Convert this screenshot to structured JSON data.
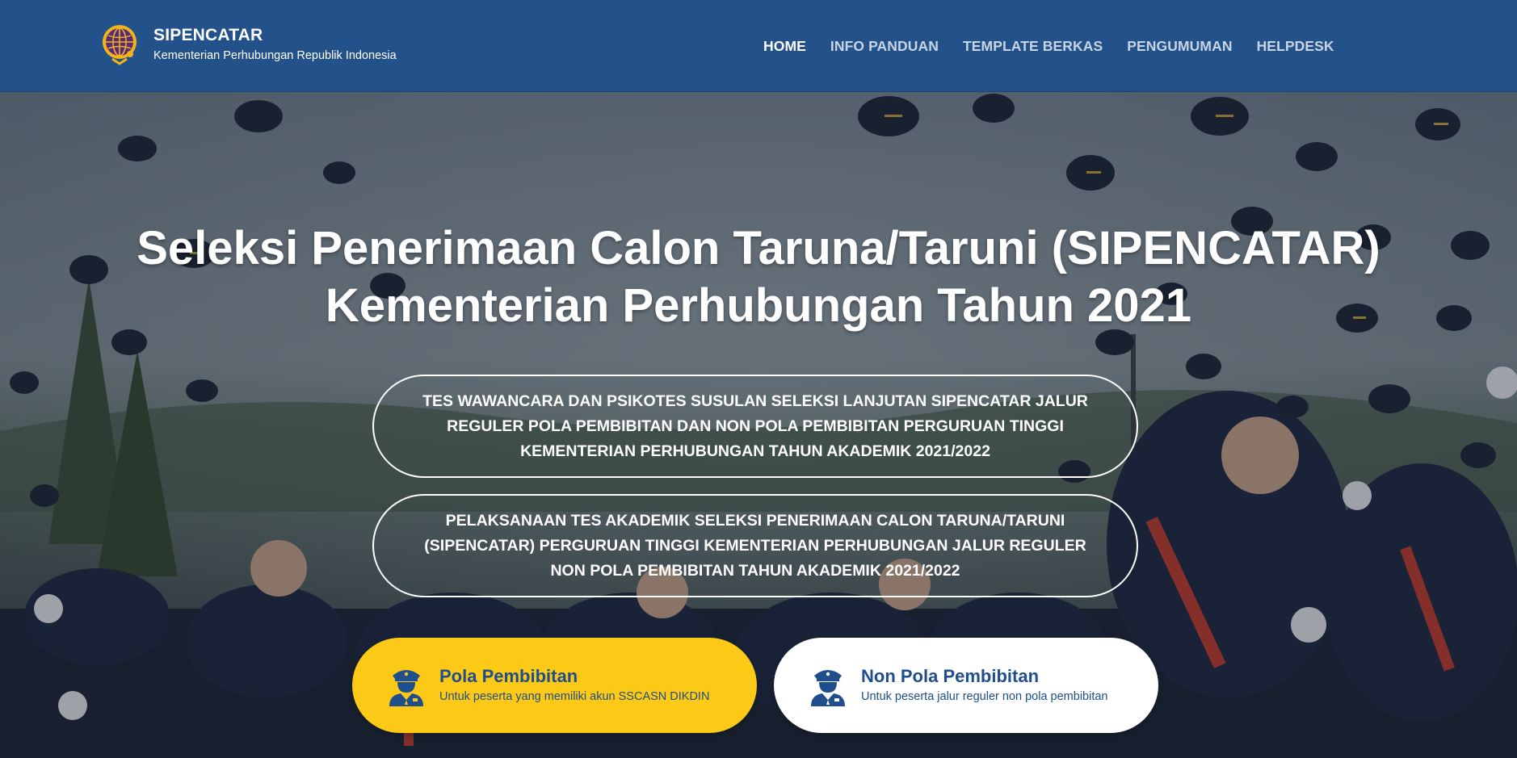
{
  "header": {
    "title": "SIPENCATAR",
    "subtitle": "Kementerian Perhubungan Republik Indonesia",
    "nav": [
      {
        "label": "HOME",
        "active": true
      },
      {
        "label": "INFO PANDUAN",
        "active": false
      },
      {
        "label": "TEMPLATE BERKAS",
        "active": false
      },
      {
        "label": "PENGUMUMAN",
        "active": false
      },
      {
        "label": "HELPDESK",
        "active": false
      }
    ]
  },
  "hero": {
    "title_line1": "Seleksi Penerimaan Calon Taruna/Taruni (SIPENCATAR)",
    "title_line2": "Kementerian Perhubungan Tahun 2021",
    "announcements": [
      "TES WAWANCARA DAN PSIKOTES SUSULAN SELEKSI LANJUTAN SIPENCATAR JALUR REGULER POLA PEMBIBITAN DAN NON POLA PEMBIBITAN PERGURUAN TINGGI KEMENTERIAN PERHUBUNGAN TAHUN AKADEMIK 2021/2022",
      "PELAKSANAAN TES AKADEMIK SELEKSI PENERIMAAN CALON TARUNA/TARUNI (SIPENCATAR) PERGURUAN TINGGI KEMENTERIAN PERHUBUNGAN JALUR REGULER NON POLA PEMBIBITAN TAHUN AKADEMIK 2021/2022"
    ]
  },
  "options": {
    "pola": {
      "title": "Pola Pembibitan",
      "subtitle": "Untuk peserta yang memiliki akun SSCASN DIKDIN"
    },
    "non_pola": {
      "title": "Non Pola Pembibitan",
      "subtitle": "Untuk peserta jalur reguler non pola pembibitan"
    }
  },
  "colors": {
    "header_bg": "#23528a",
    "accent_yellow": "#fbc916",
    "text_blue": "#1e4f8c"
  },
  "icons": {
    "logo": "kemenhub-globe-logo",
    "pola": "officer-icon",
    "non_pola": "officer-icon"
  }
}
